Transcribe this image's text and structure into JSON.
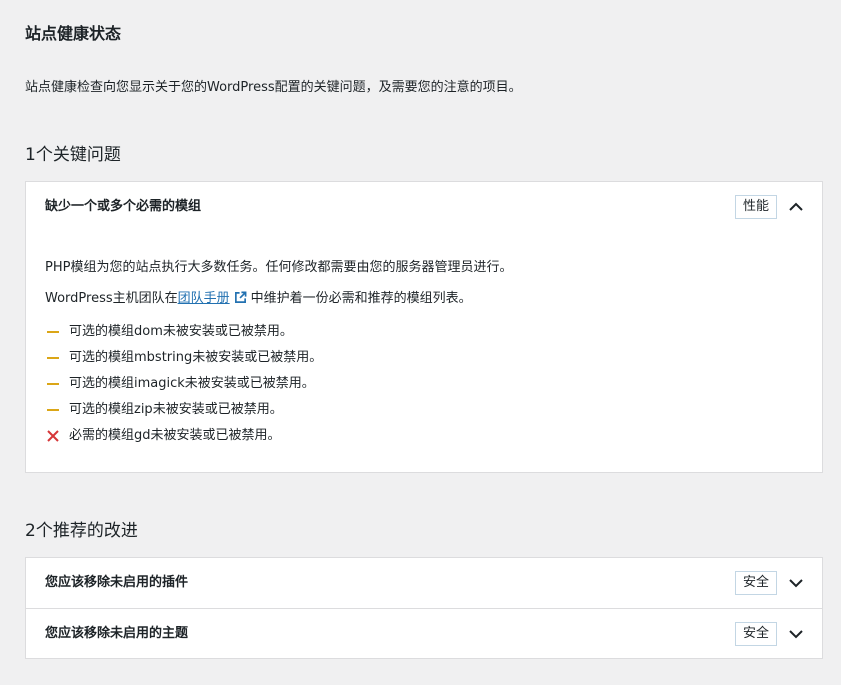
{
  "page": {
    "title": "站点健康状态",
    "description": "站点健康检查向您显示关于您的WordPress配置的关键问题，及需要您的注意的项目。"
  },
  "critical": {
    "heading": "1个关键问题",
    "issue": {
      "title": "缺少一个或多个必需的模组",
      "badge": "性能",
      "expanded": true,
      "paragraph1": "PHP模组为您的站点执行大多数任务。任何修改都需要由您的服务器管理员进行。",
      "paragraph2_before": "WordPress主机团队在",
      "paragraph2_link": "团队手册",
      "paragraph2_after": "中维护着一份必需和推荐的模组列表。",
      "items": [
        {
          "status": "warning",
          "text": "可选的模组dom未被安装或已被禁用。"
        },
        {
          "status": "warning",
          "text": "可选的模组mbstring未被安装或已被禁用。"
        },
        {
          "status": "warning",
          "text": "可选的模组imagick未被安装或已被禁用。"
        },
        {
          "status": "warning",
          "text": "可选的模组zip未被安装或已被禁用。"
        },
        {
          "status": "error",
          "text": "必需的模组gd未被安装或已被禁用。"
        }
      ]
    }
  },
  "recommended": {
    "heading": "2个推荐的改进",
    "items": [
      {
        "title": "您应该移除未启用的插件",
        "badge": "安全",
        "expanded": false
      },
      {
        "title": "您应该移除未启用的主题",
        "badge": "安全",
        "expanded": false
      }
    ]
  },
  "colors": {
    "warning": "#dba617",
    "error": "#d63638",
    "link": "#2271b1",
    "badge_border": "#c3d6e4"
  }
}
